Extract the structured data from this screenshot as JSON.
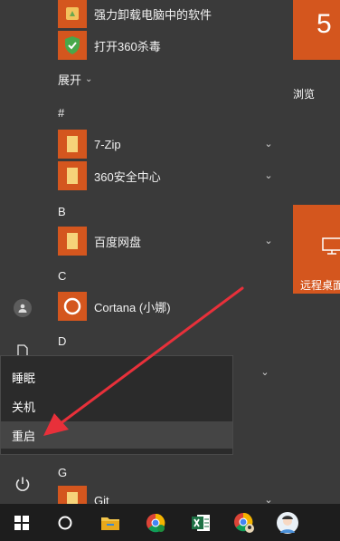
{
  "app_list": {
    "items": [
      {
        "label": "强力卸载电脑中的软件"
      },
      {
        "label": "打开360杀毒"
      },
      {
        "label": "7-Zip"
      },
      {
        "label": "360安全中心"
      },
      {
        "label": "百度网盘"
      },
      {
        "label": "Cortana (小娜)"
      },
      {
        "label": "Git"
      }
    ],
    "expand_label": "展开",
    "letters": [
      "#",
      "B",
      "C",
      "D",
      "G"
    ]
  },
  "tiles": {
    "top_tile_text": "5",
    "browse_label": "浏览",
    "remote_label": "远程桌面"
  },
  "power_menu": {
    "items": [
      "睡眠",
      "关机",
      "重启"
    ]
  },
  "colors": {
    "accent": "#d4561e",
    "annotation_arrow": "#e8303a"
  }
}
